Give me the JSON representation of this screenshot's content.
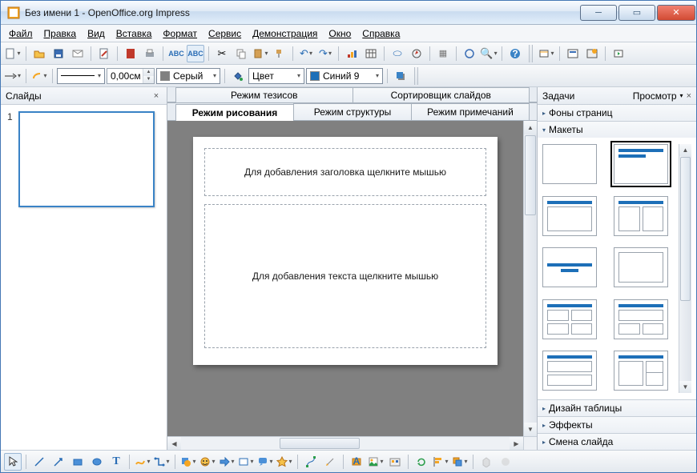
{
  "window": {
    "title": "Без имени 1 - OpenOffice.org Impress"
  },
  "menu": [
    "Файл",
    "Правка",
    "Вид",
    "Вставка",
    "Формат",
    "Сервис",
    "Демонстрация",
    "Окно",
    "Справка"
  ],
  "toolbar2": {
    "line_width": "0,00см",
    "line_color_label": "Серый",
    "line_color": "#808080",
    "fill_mode": "Цвет",
    "fill_color_label": "Синий 9",
    "fill_color": "#1d6fb8"
  },
  "slides": {
    "title": "Слайды",
    "items": [
      {
        "num": "1"
      }
    ]
  },
  "center": {
    "tabs_top": [
      "Режим тезисов",
      "Сортировщик слайдов"
    ],
    "tabs_main": [
      "Режим рисования",
      "Режим структуры",
      "Режим примечаний"
    ],
    "active_tab": 0,
    "ph_title": "Для добавления заголовка щелкните мышью",
    "ph_body": "Для добавления текста щелкните мышью"
  },
  "tasks": {
    "title": "Задачи",
    "view": "Просмотр",
    "sections": {
      "master": "Фоны страниц",
      "layouts": "Макеты",
      "table": "Дизайн таблицы",
      "effects": "Эффекты",
      "transition": "Смена слайда"
    }
  }
}
